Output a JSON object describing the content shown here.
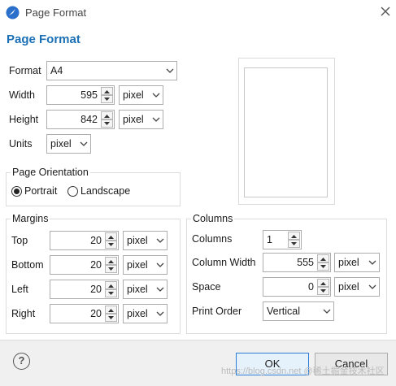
{
  "window": {
    "title": "Page Format"
  },
  "heading": "Page Format",
  "format": {
    "label": "Format",
    "value": "A4"
  },
  "width": {
    "label": "Width",
    "value": "595",
    "unit": "pixel"
  },
  "height": {
    "label": "Height",
    "value": "842",
    "unit": "pixel"
  },
  "units": {
    "label": "Units",
    "value": "pixel"
  },
  "orientation": {
    "title": "Page Orientation",
    "portrait": "Portrait",
    "landscape": "Landscape",
    "selected": "Portrait"
  },
  "margins": {
    "title": "Margins",
    "top": {
      "label": "Top",
      "value": "20",
      "unit": "pixel"
    },
    "bottom": {
      "label": "Bottom",
      "value": "20",
      "unit": "pixel"
    },
    "left": {
      "label": "Left",
      "value": "20",
      "unit": "pixel"
    },
    "right": {
      "label": "Right",
      "value": "20",
      "unit": "pixel"
    }
  },
  "columns": {
    "title": "Columns",
    "count": {
      "label": "Columns",
      "value": "1"
    },
    "width": {
      "label": "Column Width",
      "value": "555",
      "unit": "pixel"
    },
    "space": {
      "label": "Space",
      "value": "0",
      "unit": "pixel"
    },
    "order": {
      "label": "Print Order",
      "value": "Vertical"
    }
  },
  "buttons": {
    "ok": "OK",
    "cancel": "Cancel",
    "help": "?"
  },
  "watermark": "https://blog.csdn.net @稀土掘金技术社区",
  "colors": {
    "accent": "#1a6fb5",
    "ok_border": "#2b7cd3"
  }
}
